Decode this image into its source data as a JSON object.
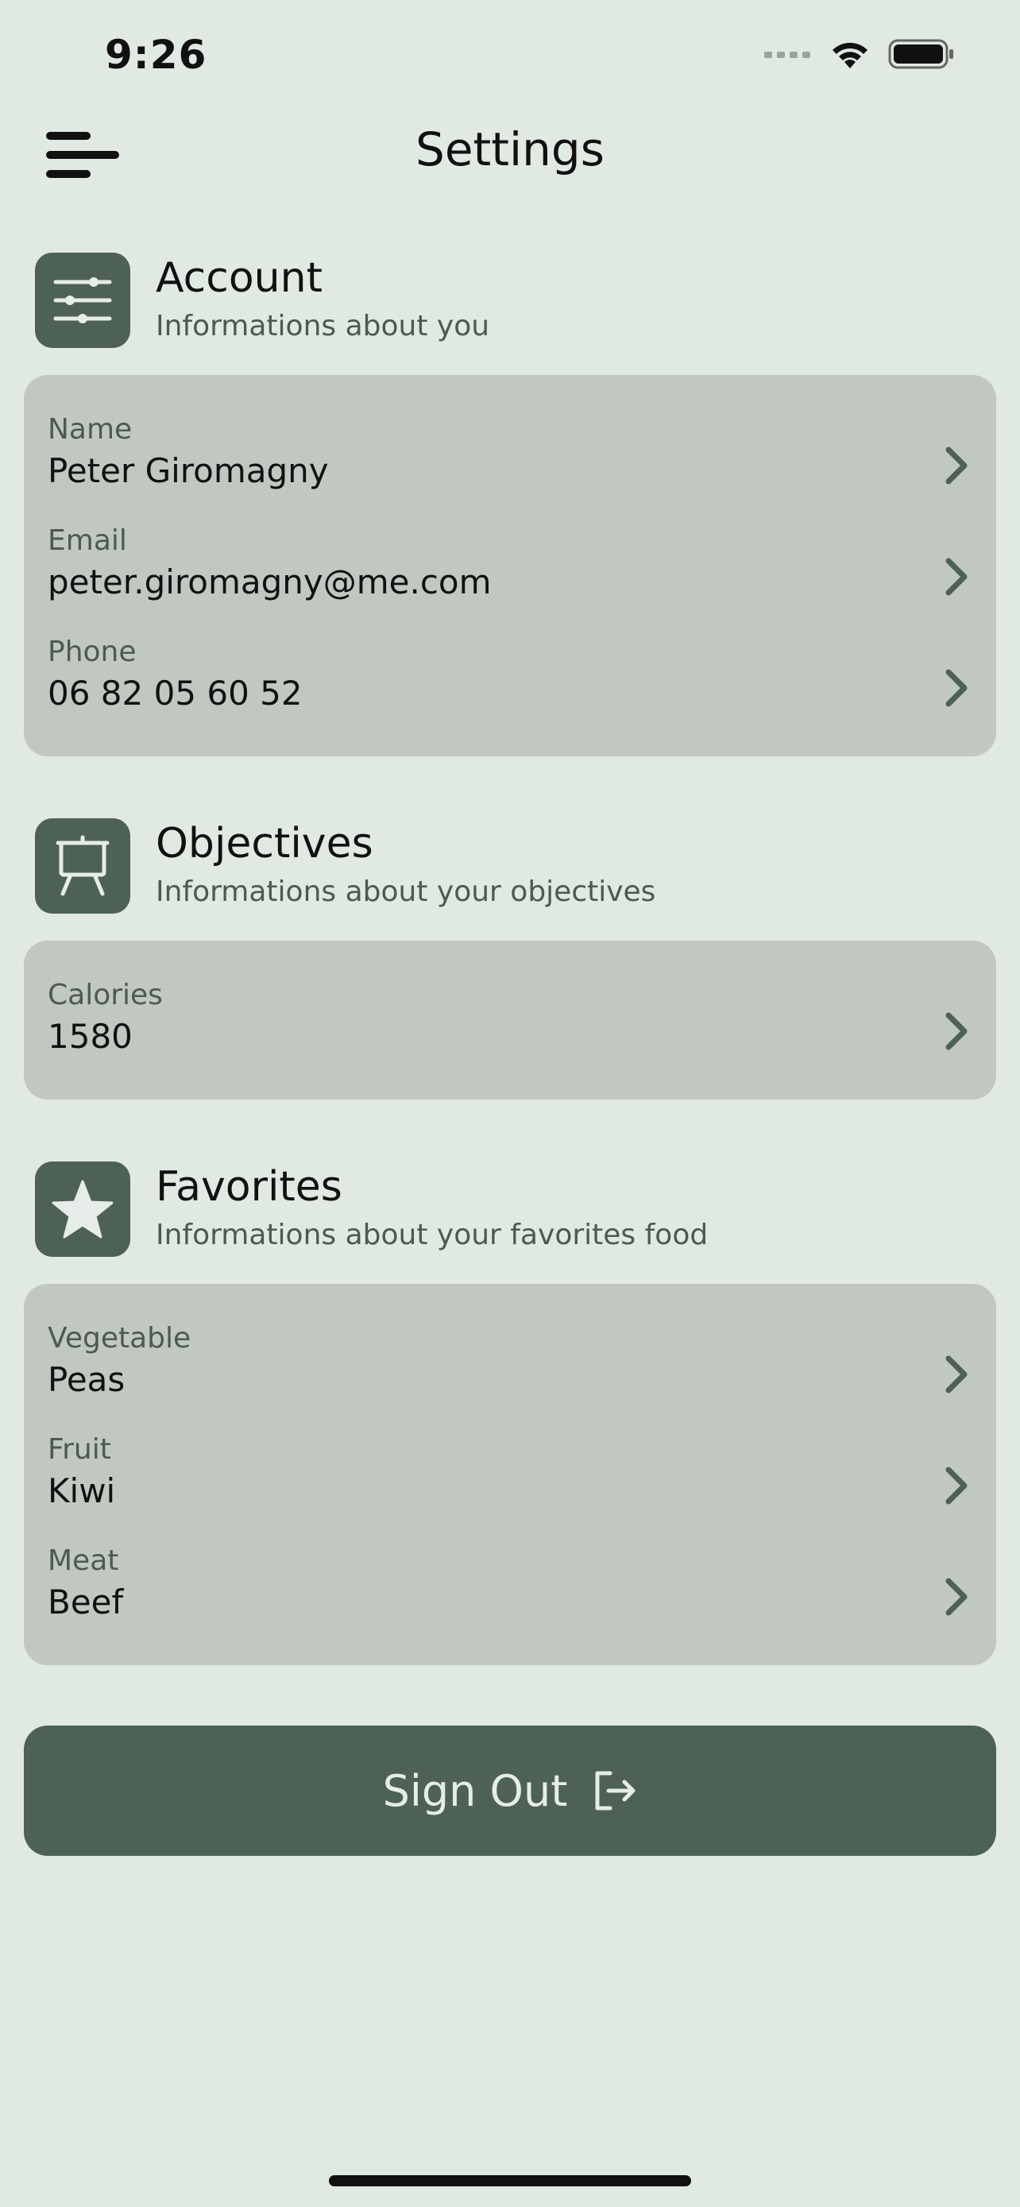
{
  "status_bar": {
    "time": "9:26"
  },
  "header": {
    "title": "Settings"
  },
  "sections": {
    "account": {
      "title": "Account",
      "subtitle": "Informations about you",
      "icon": "sliders-icon",
      "rows": [
        {
          "label": "Name",
          "value": "Peter Giromagny"
        },
        {
          "label": "Email",
          "value": "peter.giromagny@me.com"
        },
        {
          "label": "Phone",
          "value": "06 82 05 60 52"
        }
      ]
    },
    "objectives": {
      "title": "Objectives",
      "subtitle": "Informations about your objectives",
      "icon": "easel-icon",
      "rows": [
        {
          "label": "Calories",
          "value": "1580"
        }
      ]
    },
    "favorites": {
      "title": "Favorites",
      "subtitle": "Informations about your favorites food",
      "icon": "star-icon",
      "rows": [
        {
          "label": "Vegetable",
          "value": "Peas"
        },
        {
          "label": "Fruit",
          "value": "Kiwi"
        },
        {
          "label": "Meat",
          "value": "Beef"
        }
      ]
    }
  },
  "signout": {
    "label": "Sign Out",
    "icon": "logout-icon"
  },
  "colors": {
    "background": "#E0E9E2",
    "card": "#C1C8C1",
    "accent": "#4E6155",
    "muted_text": "#4C5A51"
  }
}
